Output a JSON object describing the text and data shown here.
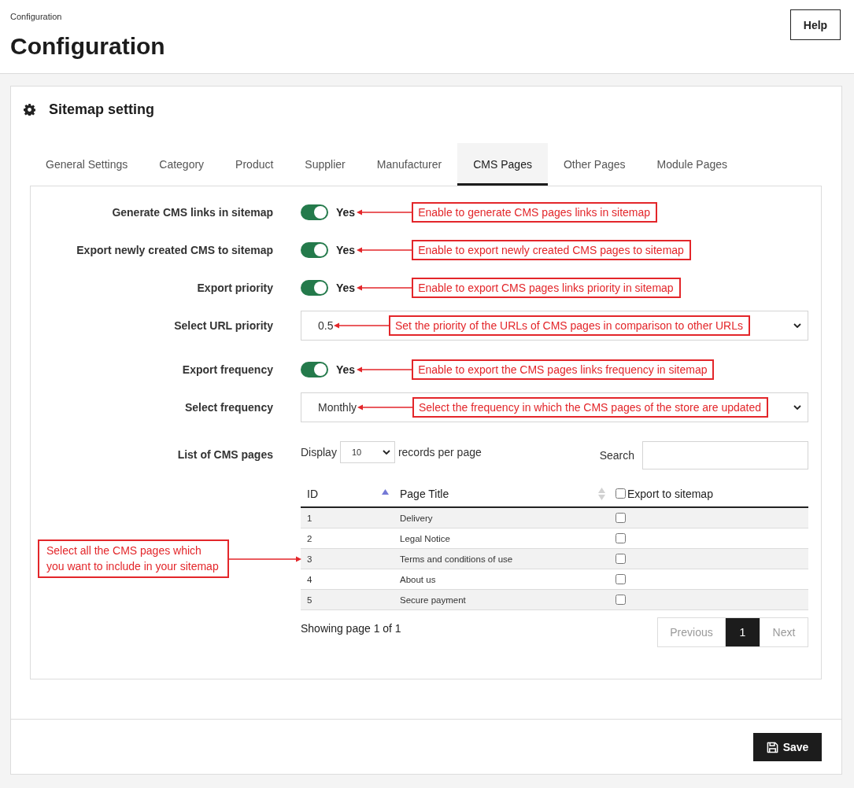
{
  "breadcrumb": "Configuration",
  "page_title": "Configuration",
  "help_button": "Help",
  "panel": {
    "title": "Sitemap setting"
  },
  "tabs": [
    {
      "label": "General Settings",
      "selected": false
    },
    {
      "label": "Category",
      "selected": false
    },
    {
      "label": "Product",
      "selected": false
    },
    {
      "label": "Supplier",
      "selected": false
    },
    {
      "label": "Manufacturer",
      "selected": false
    },
    {
      "label": "CMS Pages",
      "selected": true
    },
    {
      "label": "Other Pages",
      "selected": false
    },
    {
      "label": "Module Pages",
      "selected": false
    }
  ],
  "settings": [
    {
      "kind": "toggle",
      "label": "Generate CMS links in sitemap",
      "on": true,
      "value": "Yes",
      "callout": "Enable to generate CMS pages links in sitemap"
    },
    {
      "kind": "toggle",
      "label": "Export newly created CMS to sitemap",
      "on": true,
      "value": "Yes",
      "callout": "Enable to export newly created CMS pages to sitemap"
    },
    {
      "kind": "toggle",
      "label": "Export priority",
      "on": true,
      "value": "Yes",
      "callout": "Enable to export CMS pages links priority in sitemap"
    },
    {
      "kind": "select",
      "label": "Select URL priority",
      "value": "0.5",
      "callout": "Set the priority of the URLs of CMS pages in comparison to other URLs"
    },
    {
      "kind": "toggle",
      "label": "Export frequency",
      "on": true,
      "value": "Yes",
      "callout": "Enable to export the CMS pages links frequency in sitemap"
    },
    {
      "kind": "select",
      "label": "Select frequency",
      "value": "Monthly",
      "callout": "Select the frequency in which the CMS pages of the store are updated"
    }
  ],
  "cms_list": {
    "label": "List of CMS pages",
    "display_label": "Display",
    "page_size": "10",
    "records_label": "records per page",
    "search_label": "Search",
    "columns": [
      {
        "kind": "sortable",
        "label": "ID",
        "sorted": true
      },
      {
        "kind": "sortable",
        "label": "Page Title",
        "sorted": false
      },
      {
        "kind": "checkbox",
        "label": "Export to sitemap",
        "checked": false
      }
    ],
    "rows": [
      {
        "id": "1",
        "title": "Delivery",
        "checked": false
      },
      {
        "id": "2",
        "title": "Legal Notice",
        "checked": false
      },
      {
        "id": "3",
        "title": "Terms and conditions of use",
        "checked": false
      },
      {
        "id": "4",
        "title": "About us",
        "checked": false
      },
      {
        "id": "5",
        "title": "Secure payment",
        "checked": false
      }
    ],
    "callout": "Select all the CMS pages which\nyou want to include in your sitemap",
    "summary": "Showing page 1 of 1",
    "pagination": [
      {
        "label": "Previous",
        "selected": false,
        "disabled": true
      },
      {
        "label": "1",
        "selected": true,
        "disabled": false
      },
      {
        "label": "Next",
        "selected": false,
        "disabled": true
      }
    ]
  },
  "save_button": "Save"
}
